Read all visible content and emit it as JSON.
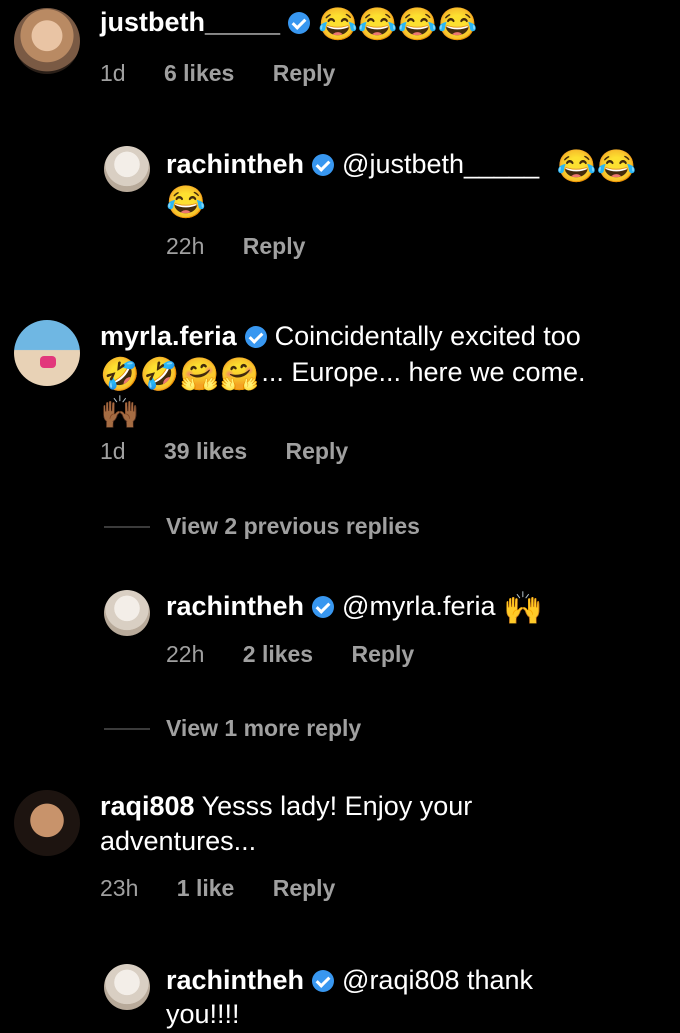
{
  "comments": [
    {
      "username": "justbeth_____",
      "emoji": "😂😂😂😂",
      "time": "1d",
      "likes": "6 likes",
      "reply": "Reply"
    },
    {
      "username": "rachintheh",
      "mention": "@justbeth_____",
      "emoji_line1": "😂😂",
      "emoji_line2": "😂",
      "time": "22h",
      "reply": "Reply"
    },
    {
      "username": "myrla.feria",
      "text_line1": "Coincidentally excited too",
      "emoji_line2": "🤣🤣🤗🤗",
      "text_line2": "... Europe... here we come.",
      "emoji_line3": "🙌🏾",
      "time": "1d",
      "likes": "39 likes",
      "reply": "Reply"
    },
    {
      "view_replies": "View 2 previous replies"
    },
    {
      "username": "rachintheh",
      "mention": "@myrla.feria",
      "emoji": "🙌",
      "time": "22h",
      "likes": "2 likes",
      "reply": "Reply"
    },
    {
      "view_replies": "View 1 more reply"
    },
    {
      "username": "raqi808",
      "text_line1": "Yesss lady! Enjoy your",
      "text_line2": "adventures...",
      "time": "23h",
      "likes": "1 like",
      "reply": "Reply"
    },
    {
      "username": "rachintheh",
      "text_line1": "@raqi808 thank",
      "text_line2": "you!!!!"
    }
  ]
}
